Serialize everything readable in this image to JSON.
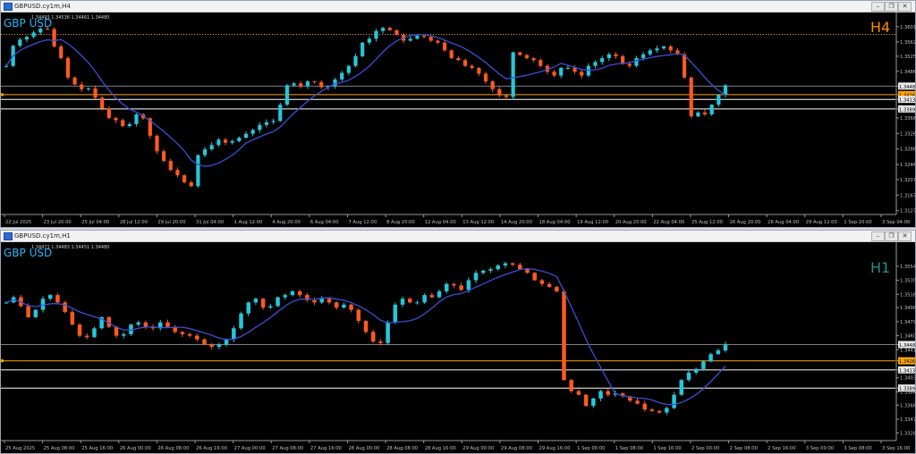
{
  "windows": [
    {
      "title": "GBPUSD.cy1m,H4",
      "symbol": "GBP USD",
      "timeframe": "H4",
      "timeframe_color": "#ff8c00",
      "ohlc_text": "1.34493 1.34536 1.34461 1.34480",
      "buttons": [
        "–",
        "❐",
        "✕"
      ]
    },
    {
      "title": "GBPUSD.cy1m,H1",
      "symbol": "GBP USD",
      "timeframe": "H1",
      "timeframe_color": "#1f8f8f",
      "ohlc_text": "1.34471 1.34483 1.34451 1.34480",
      "buttons": [
        "–",
        "❐",
        "✕"
      ]
    }
  ],
  "colors": {
    "bull": "#26c6da",
    "bear": "#ff5a1f",
    "ma": "#3a4fd6",
    "level": "#ffffff",
    "level_orange": "#ffa500",
    "grid_text": "#c0c0c0"
  },
  "chart_data": [
    {
      "type": "candlestick",
      "title": "GBP USD H4",
      "ylim": [
        1.3117,
        1.361
      ],
      "y_ticks": [
        "1.36010",
        "1.35620",
        "1.35250",
        "1.34860",
        "1.34480",
        "1.34260",
        "1.34137",
        "1.33891",
        "1.33660",
        "1.33260",
        "1.32860",
        "1.32460",
        "1.32070",
        "1.31670",
        "1.31270"
      ],
      "y_tick_values": [
        1.3601,
        1.3562,
        1.3525,
        1.3486,
        1.3448,
        1.3426,
        1.34137,
        1.33891,
        1.3366,
        1.3326,
        1.3286,
        1.3246,
        1.3207,
        1.3167,
        1.3127
      ],
      "highlight_labels": [
        "1.35812",
        "1.34480",
        "1.34260",
        "1.34137",
        "1.33891"
      ],
      "x_ticks": [
        "22 Jul 2025",
        "23 Jul 20:00",
        "25 Jul 04:00",
        "28 Jul 12:00",
        "29 Jul 20:00",
        "31 Jul 04:00",
        "1 Aug 12:00",
        "4 Aug 20:00",
        "6 Aug 04:00",
        "7 Aug 12:00",
        "8 Aug 20:00",
        "12 Aug 04:00",
        "13 Aug 12:00",
        "14 Aug 20:00",
        "18 Aug 04:00",
        "19 Aug 12:00",
        "20 Aug 20:00",
        "22 Aug 04:00",
        "25 Aug 12:00",
        "26 Aug 20:00",
        "28 Aug 04:00",
        "29 Aug 12:00",
        "1 Sep 20:00",
        "3 Sep 04:00"
      ],
      "levels": [
        {
          "price": 1.35812,
          "color": "#ffa500",
          "style": "dotted"
        },
        {
          "price": 1.3448,
          "color": "#808080",
          "style": "solid"
        },
        {
          "price": 1.3426,
          "color": "#ffa500",
          "style": "solid"
        },
        {
          "price": 1.34137,
          "color": "#ffffff",
          "style": "solid"
        },
        {
          "price": 1.33891,
          "color": "#ffffff",
          "style": "solid"
        }
      ],
      "price_path": [
        1.35,
        1.3552,
        1.3568,
        1.3575,
        1.3586,
        1.3596,
        1.3595,
        1.355,
        1.352,
        1.347,
        1.3452,
        1.344,
        1.3442,
        1.3418,
        1.339,
        1.3366,
        1.336,
        1.3345,
        1.335,
        1.3375,
        1.3365,
        1.332,
        1.328,
        1.3255,
        1.3232,
        1.3218,
        1.32,
        1.319,
        1.327,
        1.3285,
        1.3296,
        1.331,
        1.3302,
        1.3306,
        1.3315,
        1.3325,
        1.3335,
        1.3348,
        1.3355,
        1.3358,
        1.34,
        1.345,
        1.3455,
        1.3448,
        1.346,
        1.3458,
        1.3445,
        1.3448,
        1.3465,
        1.3482,
        1.35,
        1.3525,
        1.356,
        1.357,
        1.359,
        1.3598,
        1.3592,
        1.358,
        1.3565,
        1.357,
        1.3578,
        1.3575,
        1.3565,
        1.356,
        1.354,
        1.352,
        1.3515,
        1.35,
        1.3495,
        1.348,
        1.346,
        1.344,
        1.3424,
        1.342,
        1.3535,
        1.3528,
        1.352,
        1.3515,
        1.35,
        1.3485,
        1.3475,
        1.3495,
        1.3495,
        1.3485,
        1.3475,
        1.35,
        1.351,
        1.352,
        1.353,
        1.3525,
        1.3505,
        1.35,
        1.352,
        1.353,
        1.354,
        1.3545,
        1.355,
        1.354,
        1.353,
        1.347,
        1.337,
        1.338,
        1.3375,
        1.34,
        1.3425,
        1.345
      ],
      "moving_average": true
    },
    {
      "type": "candlestick",
      "title": "GBP USD H1",
      "ylim": [
        1.3318,
        1.3572
      ],
      "y_ticks": [
        "1.35540",
        "1.35350",
        "1.35160",
        "1.34980",
        "1.34790",
        "1.34600",
        "1.34480",
        "1.34410",
        "1.34260",
        "1.34137",
        "1.34030",
        "1.33891",
        "1.33840",
        "1.33660",
        "1.33470",
        "1.33285"
      ],
      "y_tick_values": [
        1.3554,
        1.3535,
        1.3516,
        1.3498,
        1.3479,
        1.346,
        1.3448,
        1.3441,
        1.3426,
        1.34137,
        1.3403,
        1.33891,
        1.3384,
        1.3366,
        1.3347,
        1.33285
      ],
      "highlight_labels": [
        "1.34480",
        "1.34260",
        "1.34137",
        "1.33891"
      ],
      "x_ticks": [
        "25 Aug 2025",
        "25 Aug 08:00",
        "25 Aug 16:00",
        "26 Aug 00:00",
        "26 Aug 08:00",
        "26 Aug 16:00",
        "27 Aug 00:00",
        "27 Aug 08:00",
        "27 Aug 16:00",
        "28 Aug 00:00",
        "28 Aug 08:00",
        "28 Aug 16:00",
        "29 Aug 00:00",
        "29 Aug 08:00",
        "29 Aug 16:00",
        "1 Sep 00:00",
        "1 Sep 08:00",
        "1 Sep 16:00",
        "2 Sep 00:00",
        "2 Sep 08:00",
        "2 Sep 16:00",
        "3 Sep 00:00",
        "3 Sep 08:00",
        "3 Sep 16:00"
      ],
      "levels": [
        {
          "price": 1.3448,
          "color": "#808080",
          "style": "solid"
        },
        {
          "price": 1.3426,
          "color": "#ffa500",
          "style": "solid"
        },
        {
          "price": 1.34137,
          "color": "#ffffff",
          "style": "solid"
        },
        {
          "price": 1.33891,
          "color": "#ffffff",
          "style": "solid"
        }
      ],
      "price_path": [
        1.3505,
        1.3512,
        1.35,
        1.3485,
        1.3495,
        1.351,
        1.3515,
        1.3505,
        1.3492,
        1.3475,
        1.346,
        1.3458,
        1.347,
        1.3485,
        1.3472,
        1.346,
        1.3462,
        1.3475,
        1.3478,
        1.3472,
        1.347,
        1.3478,
        1.3472,
        1.3465,
        1.3462,
        1.346,
        1.3455,
        1.3448,
        1.3445,
        1.3448,
        1.3455,
        1.347,
        1.349,
        1.3505,
        1.351,
        1.3498,
        1.35,
        1.3512,
        1.3515,
        1.352,
        1.3515,
        1.3508,
        1.3505,
        1.351,
        1.3505,
        1.3498,
        1.3502,
        1.3495,
        1.348,
        1.3465,
        1.3452,
        1.345,
        1.3478,
        1.3502,
        1.351,
        1.3505,
        1.3505,
        1.3515,
        1.3512,
        1.352,
        1.353,
        1.3528,
        1.3522,
        1.3535,
        1.3545,
        1.3548,
        1.355,
        1.3555,
        1.3558,
        1.3556,
        1.355,
        1.3545,
        1.3535,
        1.353,
        1.3526,
        1.352,
        1.34,
        1.3385,
        1.338,
        1.3365,
        1.3375,
        1.3385,
        1.338,
        1.3382,
        1.3378,
        1.3372,
        1.3368,
        1.336,
        1.3358,
        1.3356,
        1.3362,
        1.338,
        1.34,
        1.341,
        1.3415,
        1.3425,
        1.3435,
        1.344,
        1.3448
      ],
      "moving_average": true
    }
  ]
}
